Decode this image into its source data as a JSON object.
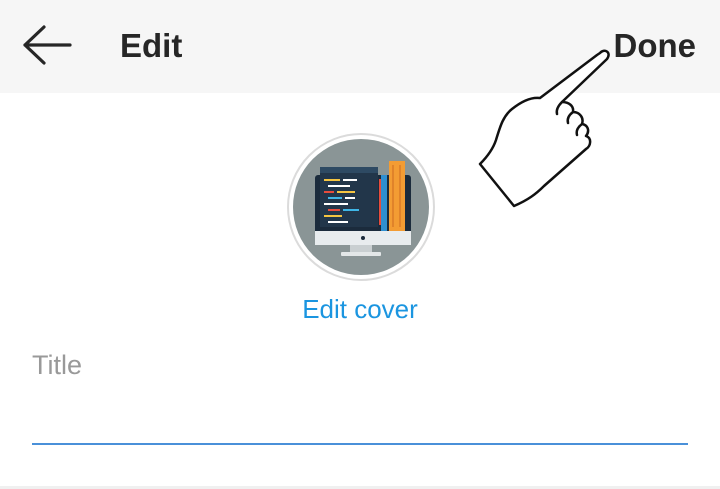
{
  "header": {
    "back_icon": "arrow-left-icon",
    "title": "Edit",
    "done_label": "Done"
  },
  "cover": {
    "image_icon": "desktop-code-icon",
    "edit_label": "Edit cover"
  },
  "title_field": {
    "value": "",
    "placeholder": "Title"
  },
  "annotation": {
    "icon": "pointing-hand-icon"
  },
  "colors": {
    "header_bg": "#f6f6f6",
    "text": "#262626",
    "accent_link": "#1b95e0",
    "input_underline": "#4a90d9",
    "placeholder": "#999999"
  }
}
